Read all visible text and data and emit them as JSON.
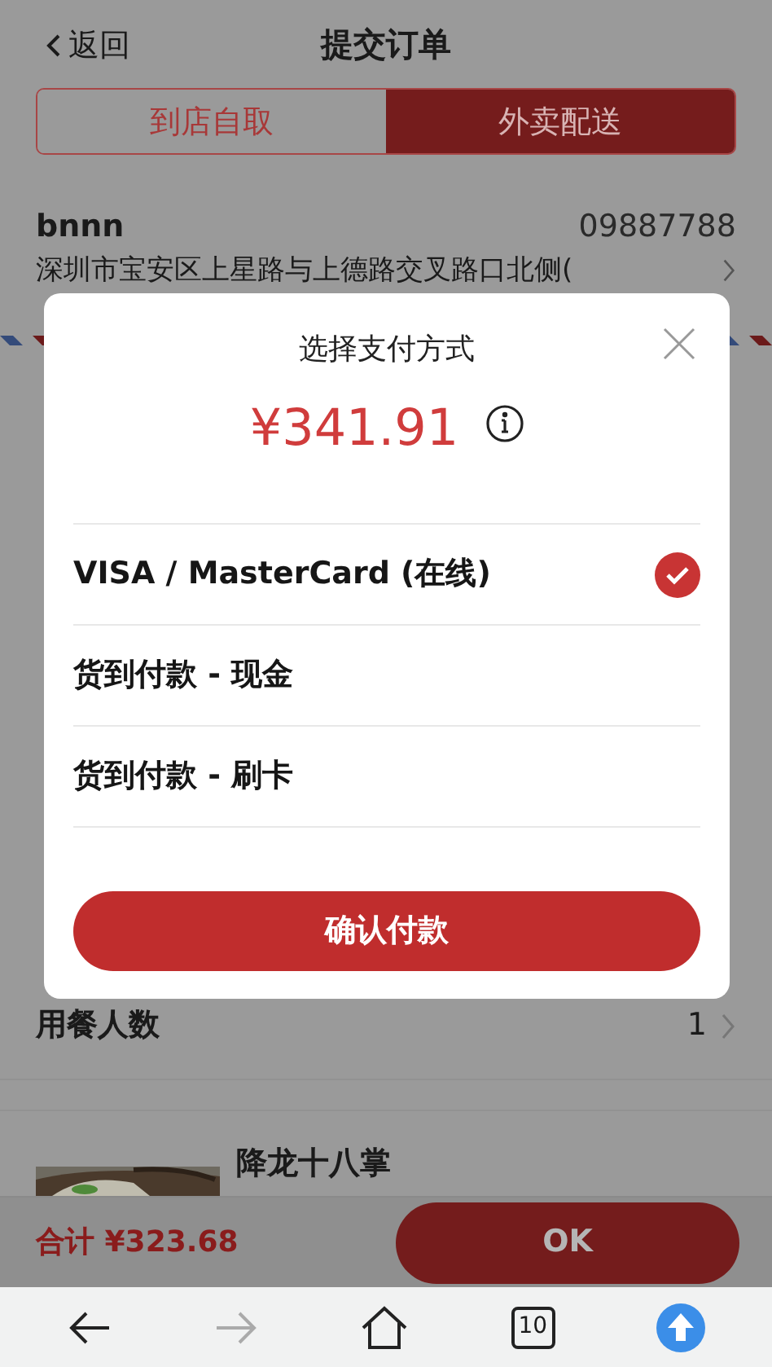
{
  "header": {
    "back": "返回",
    "title": "提交订单"
  },
  "tabs": [
    {
      "label": "到店自取",
      "selected": false
    },
    {
      "label": "外卖配送",
      "selected": true
    }
  ],
  "contact": {
    "name": "bnnn",
    "phone": "09887788",
    "address": "深圳市宝安区上星路与上德路交叉路口北侧("
  },
  "diners": {
    "label": "用餐人数",
    "value": "1"
  },
  "dish": {
    "name": "降龙十八掌"
  },
  "footer": {
    "total": "合计 ¥323.68",
    "button": "OK"
  },
  "dialog": {
    "title": "选择支付方式",
    "amount": "¥341.91",
    "methods": [
      {
        "label": "VISA / MasterCard (在线)",
        "selected": true
      },
      {
        "label": "货到付款 - 现金",
        "selected": false
      },
      {
        "label": "货到付款 - 刷卡",
        "selected": false
      }
    ],
    "confirm": "确认付款"
  },
  "browser": {
    "tab_count": "10"
  }
}
